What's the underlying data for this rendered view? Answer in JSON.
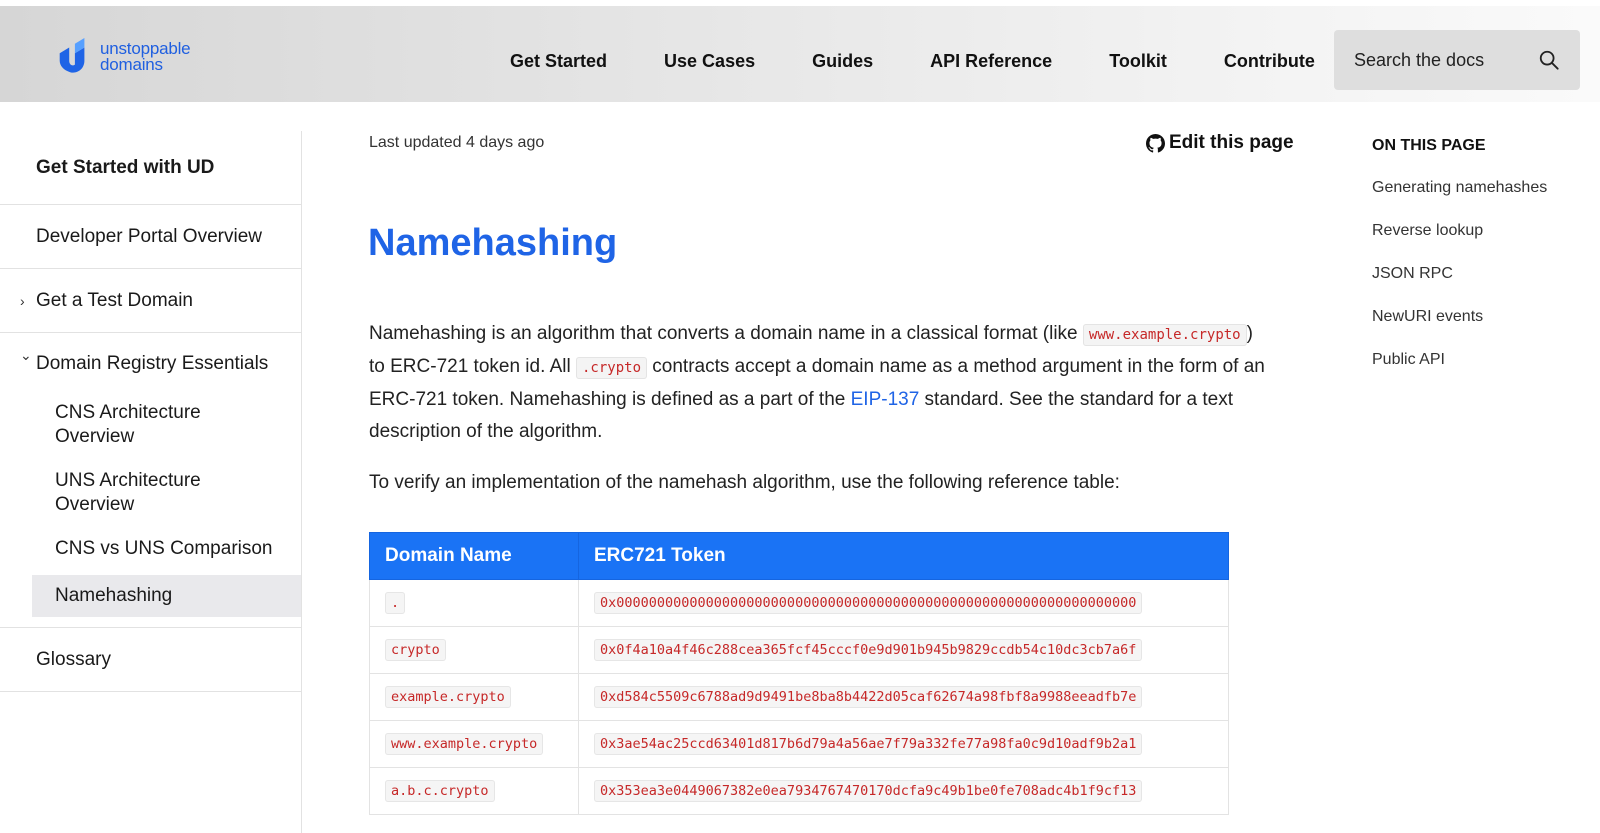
{
  "header": {
    "logo": {
      "line1": "unstoppable",
      "line2": "domains"
    },
    "nav": [
      "Get Started",
      "Use Cases",
      "Guides",
      "API Reference",
      "Toolkit",
      "Contribute"
    ],
    "search": {
      "placeholder": "Search the docs"
    }
  },
  "sidebar": {
    "items": [
      {
        "label": "Get Started with UD"
      },
      {
        "label": "Developer Portal Overview"
      },
      {
        "label": "Get a Test Domain",
        "caret": "›"
      },
      {
        "label": "Domain Registry Essentials",
        "caret": "⌄",
        "children": [
          "CNS Architecture Overview",
          "UNS Architecture Overview",
          "CNS vs UNS Comparison",
          "Namehashing"
        ]
      },
      {
        "label": "Glossary"
      }
    ]
  },
  "main": {
    "last_updated": "Last updated 4 days ago",
    "edit_label": "Edit this page",
    "title": "Namehashing",
    "p1": {
      "t1": "Namehashing is an algorithm that converts a domain name in a classical format (like ",
      "code1": "www.example.crypto",
      "t2": ") to ERC-721 token id. All ",
      "code2": ".crypto",
      "t3": " contracts accept a domain name as a method argument in the form of an ERC-721 token. Namehashing is defined as a part of the ",
      "link": "EIP-137",
      "t4": " standard. See the standard for a text description of the algorithm."
    },
    "p2": "To verify an implementation of the namehash algorithm, use the following reference table:",
    "table": {
      "headers": [
        "Domain Name",
        "ERC721 Token"
      ],
      "rows": [
        [
          ".",
          "0x0000000000000000000000000000000000000000000000000000000000000000"
        ],
        [
          "crypto",
          "0x0f4a10a4f46c288cea365fcf45cccf0e9d901b945b9829ccdb54c10dc3cb7a6f"
        ],
        [
          "example.crypto",
          "0xd584c5509c6788ad9d9491be8ba8b4422d05caf62674a98fbf8a9988eeadfb7e"
        ],
        [
          "www.example.crypto",
          "0x3ae54ac25ccd63401d817b6d79a4a56ae7f79a332fe77a98fa0c9d10adf9b2a1"
        ],
        [
          "a.b.c.crypto",
          "0x353ea3e0449067382e0ea7934767470170dcfa9c49b1be0fe708adc4b1f9cf13"
        ]
      ]
    }
  },
  "toc": {
    "title": "ON THIS PAGE",
    "items": [
      "Generating namehashes",
      "Reverse lookup",
      "JSON RPC",
      "NewURI events",
      "Public API"
    ]
  },
  "colors": {
    "accent": "#1f64e6",
    "table_header": "#1a73f5",
    "code": "#c62828"
  }
}
